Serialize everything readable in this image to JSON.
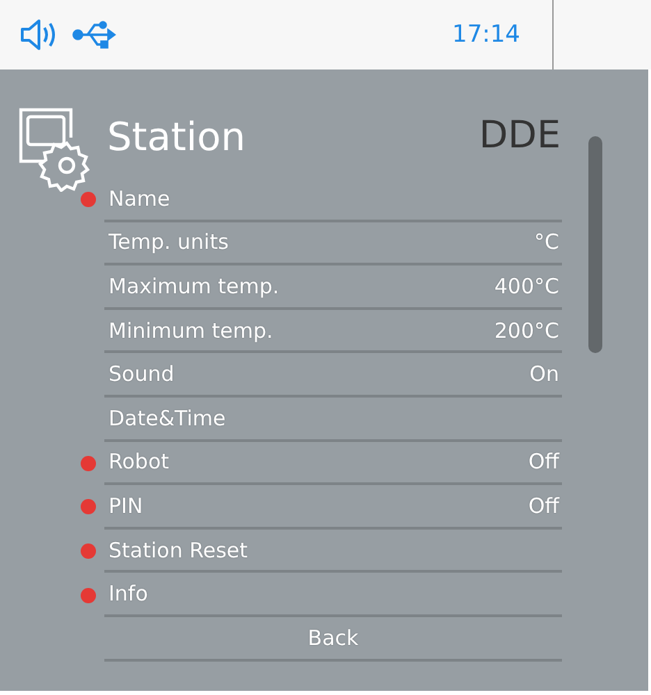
{
  "status_bar": {
    "time": "17:14"
  },
  "header": {
    "title": "Station",
    "model": "DDE"
  },
  "menu": [
    {
      "label": "Name",
      "alert": true
    },
    {
      "label": "Temp. units",
      "value": "°C",
      "alert": false
    },
    {
      "label": "Maximum temp.",
      "value": "400°C",
      "alert": false
    },
    {
      "label": "Minimum temp.",
      "value": "200°C",
      "alert": false
    },
    {
      "label": "Sound",
      "value": "On",
      "alert": false
    },
    {
      "label": "Date&Time",
      "alert": false
    },
    {
      "label": "Robot",
      "value": "Off",
      "alert": true
    },
    {
      "label": "PIN",
      "value": "Off",
      "alert": true
    },
    {
      "label": "Station Reset",
      "alert": true
    },
    {
      "label": "Info",
      "alert": true
    }
  ],
  "back_button": "Back"
}
